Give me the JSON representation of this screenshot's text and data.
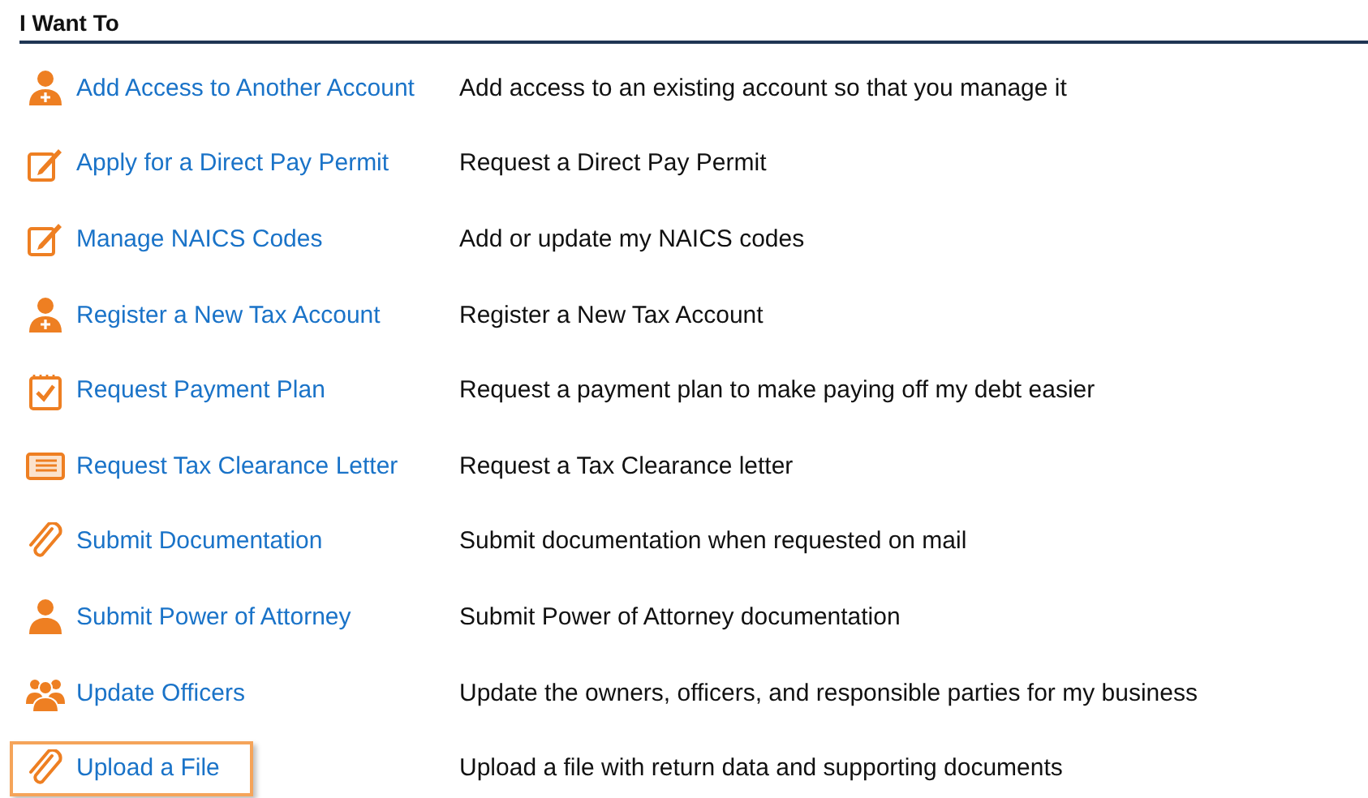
{
  "heading": "I Want To",
  "items": [
    {
      "kind": "person-add",
      "label": "Add Access to Another Account",
      "description": "Add access to an existing account so that you manage it",
      "selected": false
    },
    {
      "kind": "edit",
      "label": "Apply for a Direct Pay Permit",
      "description": "Request a Direct Pay Permit",
      "selected": false
    },
    {
      "kind": "edit",
      "label": "Manage NAICS Codes",
      "description": "Add or update my NAICS codes",
      "selected": false
    },
    {
      "kind": "person-add",
      "label": "Register a New Tax Account",
      "description": "Register a New Tax Account",
      "selected": false
    },
    {
      "kind": "calendar",
      "label": "Request Payment Plan",
      "description": "Request a payment plan to make paying off my debt easier",
      "selected": false
    },
    {
      "kind": "letter",
      "label": "Request Tax Clearance Letter",
      "description": "Request a Tax Clearance letter",
      "selected": false
    },
    {
      "kind": "attach",
      "label": "Submit Documentation",
      "description": "Submit documentation when requested on mail",
      "selected": false
    },
    {
      "kind": "person",
      "label": "Submit Power of Attorney",
      "description": "Submit Power of Attorney documentation",
      "selected": false
    },
    {
      "kind": "group",
      "label": "Update Officers",
      "description": "Update the owners, officers, and responsible parties for my business",
      "selected": false
    },
    {
      "kind": "attach",
      "label": "Upload a File",
      "description": "Upload a file with return data and supporting documents",
      "selected": true
    }
  ]
}
